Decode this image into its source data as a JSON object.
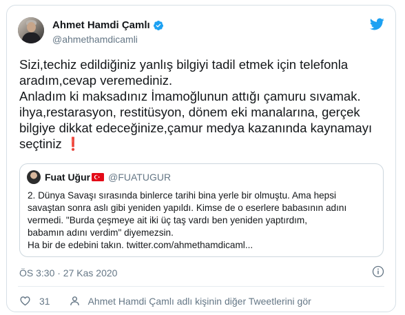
{
  "author": {
    "display_name": "Ahmet Hamdi Çamlı",
    "handle": "@ahmethamdicamli",
    "verified": true
  },
  "tweet": {
    "text_main": "Sizi,techiz edildiğiniz yanlış bilgiyi tadil etmek için telefonla\naradım,cevap veremediniz.\nAnladım ki maksadınız İmamoğlunun attığı çamuru sıvamak.\nihya,restarasyon, restitüsyon, dönem eki manalarına, gerçek\nbilgiye dikkat edeceğinize,çamur medya kazanında kaynamayı\nseçtiniz ",
    "emoji": "❗"
  },
  "quoted_tweet": {
    "display_name": "Fuat Uğur",
    "handle": "@FUATUGUR",
    "text": "2. Dünya Savaşı sırasında binlerce tarihi bina yerle bir olmuştu. Ama hepsi\nsavaştan sonra aslı gibi yeniden yapıldı. Kimse de o eserlere babasının adını\nvermedi. \"Burda çeşmeye ait iki üç taş vardı ben yeniden yaptırdım,\nbabamın adını verdim\" diyemezsin.\nHa bir de edebini takın. twitter.com/ahmethamdicaml..."
  },
  "timestamp": "ÖS 3:30 · 27 Kas 2020",
  "footer": {
    "like_count": "31",
    "more_tweets_label": "Ahmet Hamdi Çamlı adlı kişinin diğer Tweetlerini gör"
  },
  "colors": {
    "twitter_blue": "#1da1f2",
    "text_secondary": "#657786",
    "border": "#ccd6dd"
  },
  "icons": [
    "twitter-bird-icon",
    "verified-badge-icon",
    "turkey-flag-icon",
    "info-icon",
    "heart-icon",
    "person-icon"
  ]
}
